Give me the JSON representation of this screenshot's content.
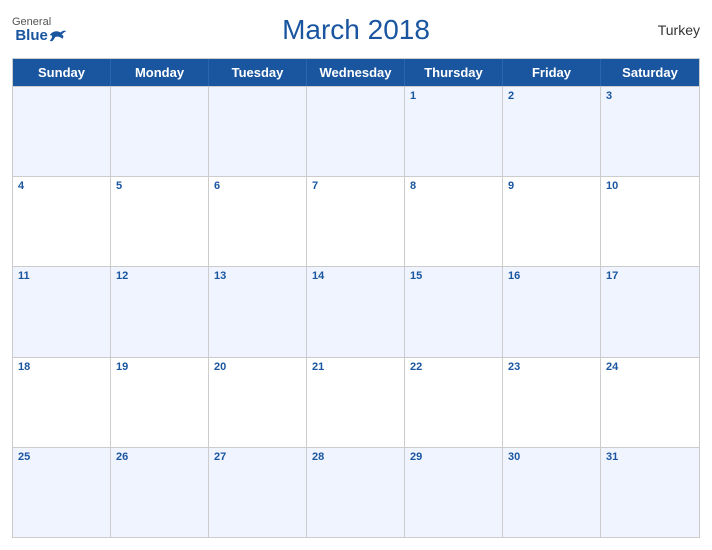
{
  "header": {
    "title": "March 2018",
    "country": "Turkey",
    "logo": {
      "general": "General",
      "blue": "Blue"
    }
  },
  "days_of_week": [
    "Sunday",
    "Monday",
    "Tuesday",
    "Wednesday",
    "Thursday",
    "Friday",
    "Saturday"
  ],
  "weeks": [
    [
      {
        "date": "",
        "empty": true
      },
      {
        "date": "",
        "empty": true
      },
      {
        "date": "",
        "empty": true
      },
      {
        "date": "",
        "empty": true
      },
      {
        "date": "1"
      },
      {
        "date": "2"
      },
      {
        "date": "3"
      }
    ],
    [
      {
        "date": "4"
      },
      {
        "date": "5"
      },
      {
        "date": "6"
      },
      {
        "date": "7"
      },
      {
        "date": "8"
      },
      {
        "date": "9"
      },
      {
        "date": "10"
      }
    ],
    [
      {
        "date": "11"
      },
      {
        "date": "12"
      },
      {
        "date": "13"
      },
      {
        "date": "14"
      },
      {
        "date": "15"
      },
      {
        "date": "16"
      },
      {
        "date": "17"
      }
    ],
    [
      {
        "date": "18"
      },
      {
        "date": "19"
      },
      {
        "date": "20"
      },
      {
        "date": "21"
      },
      {
        "date": "22"
      },
      {
        "date": "23"
      },
      {
        "date": "24"
      }
    ],
    [
      {
        "date": "25"
      },
      {
        "date": "26"
      },
      {
        "date": "27"
      },
      {
        "date": "28"
      },
      {
        "date": "29"
      },
      {
        "date": "30"
      },
      {
        "date": "31"
      }
    ]
  ]
}
